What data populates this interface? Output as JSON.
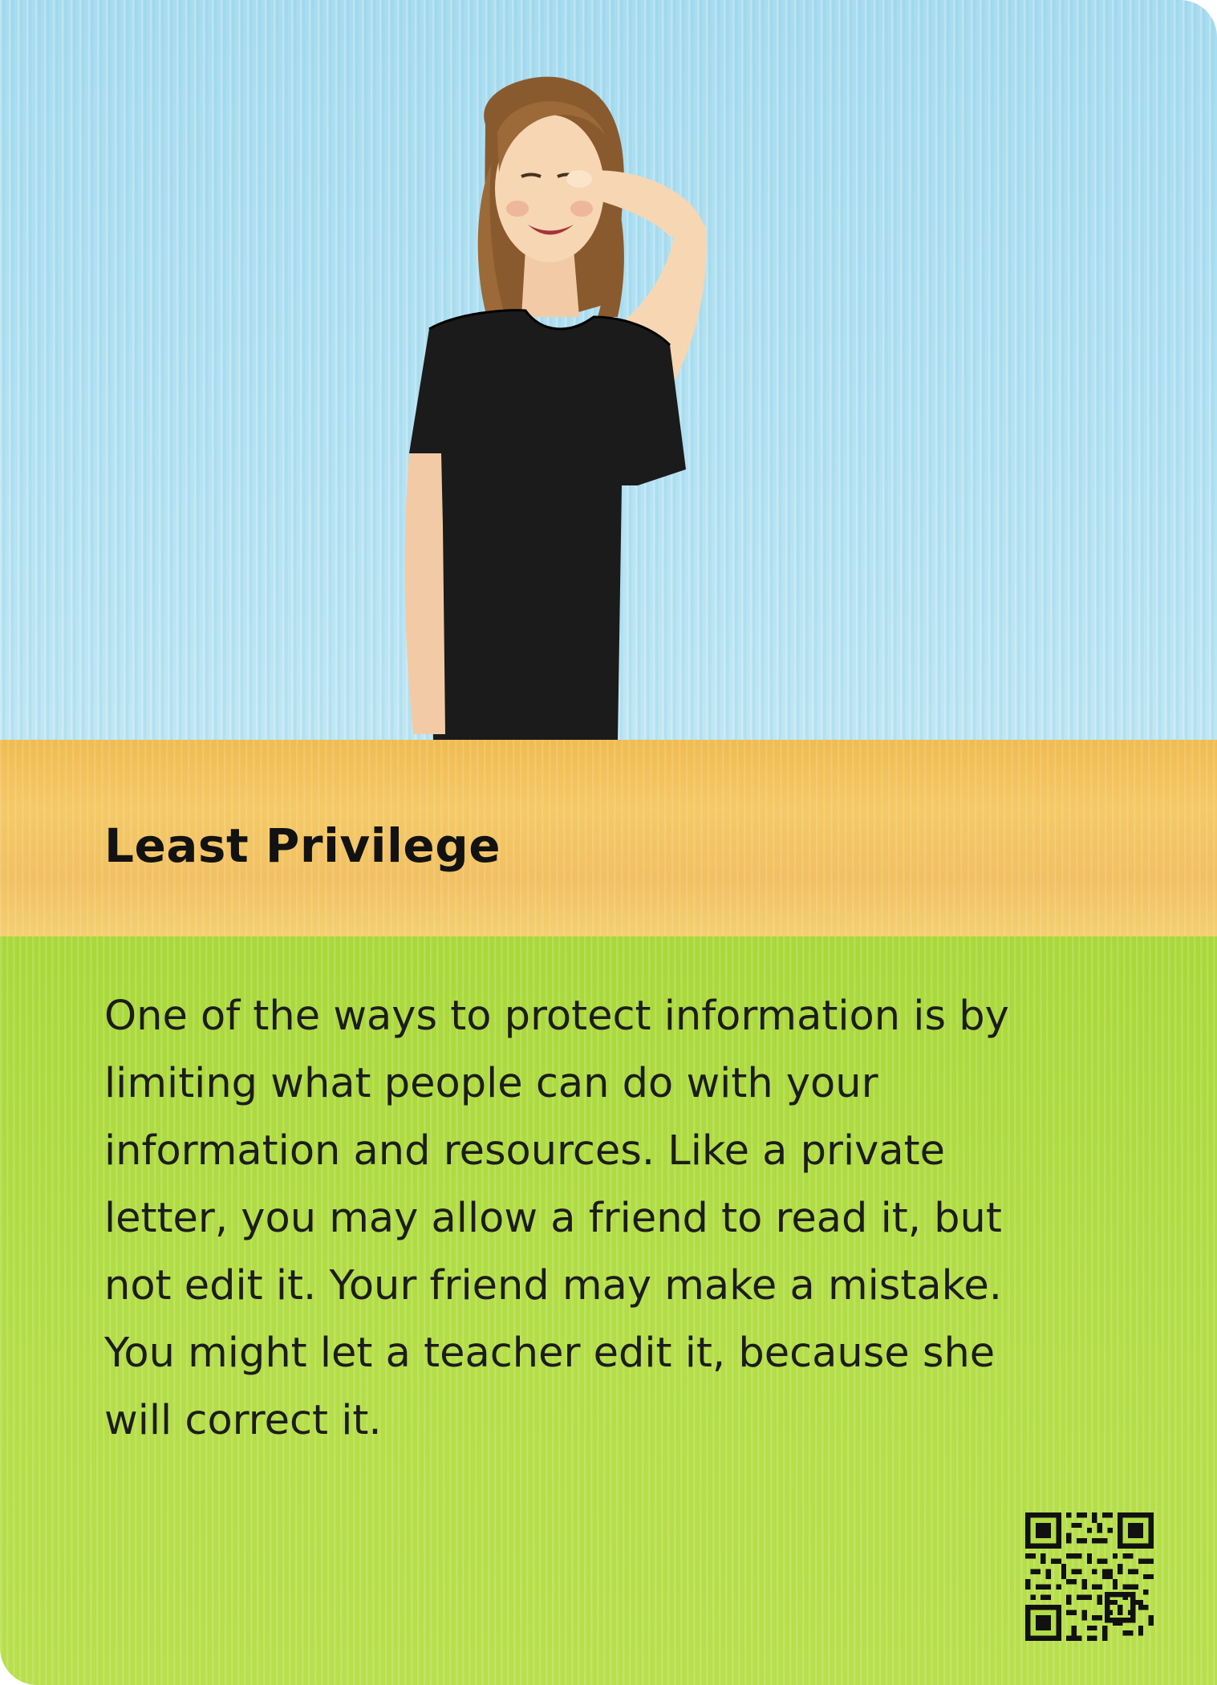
{
  "card": {
    "title": "Least Privilege",
    "body": "One of the ways to protect information is by limiting what people can do with your information and resources. Like a private letter, you may allow a friend to read it, but not edit it. Your friend may make a mistake. You might let a teacher edit it, because she will correct it."
  },
  "icons": {
    "photo": "person-signing-illustration",
    "code": "qr-code-icon"
  },
  "colors": {
    "photo_background": "#b5e2f2",
    "title_band": "#f2c35f",
    "body_background": "#b3dd46",
    "text": "#1c1c1c"
  }
}
